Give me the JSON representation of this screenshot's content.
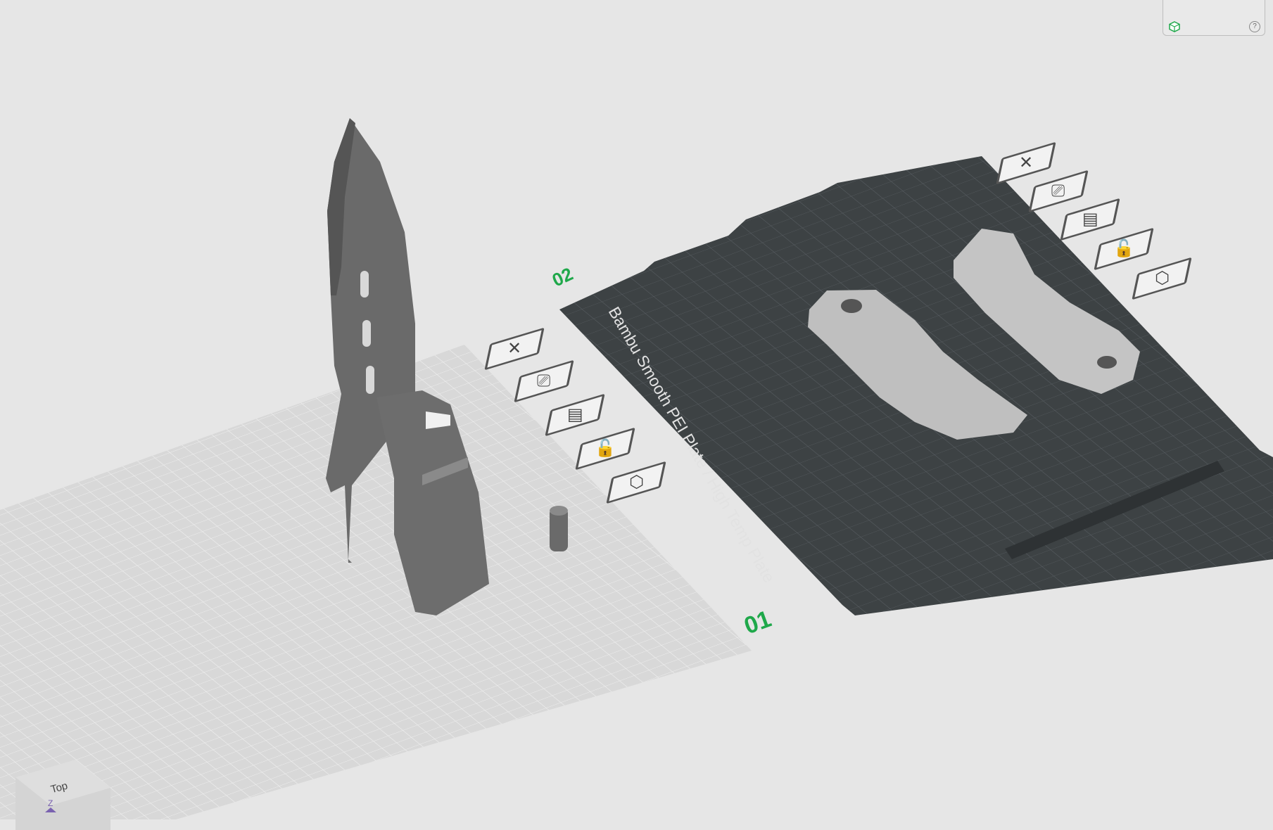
{
  "plate1": {
    "number": "01"
  },
  "plate2": {
    "number": "02",
    "plate_type_label": "Bambu Smooth PEI Plate / High Temp Plate"
  },
  "viewcube": {
    "face_label": "Top",
    "axis_label": "Z"
  },
  "thumbnail": {
    "help": "?"
  },
  "colors": {
    "plate_number": "#1fa84a",
    "active_plate": "#3d4244",
    "inactive_plate": "#d8d8d8",
    "grid_line": "#5a6064",
    "model": "#6a6a6a"
  }
}
